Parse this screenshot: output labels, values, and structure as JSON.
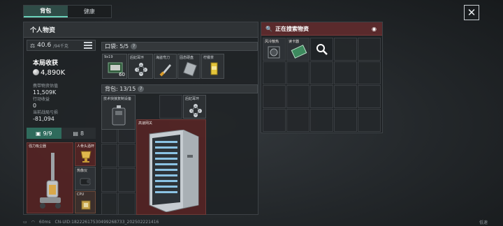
{
  "tabs": [
    {
      "label": "背包",
      "active": true
    },
    {
      "label": "健康",
      "active": false
    }
  ],
  "personal": {
    "title": "个人物资",
    "weight": {
      "value": "40.6",
      "max": "/94千克"
    },
    "round_income_title": "本局收获",
    "round_income_value": "4,890K",
    "carry_label": "携带物资估值",
    "carry_value": "11,509K",
    "action_label": "行动收益",
    "action_value": "0",
    "current_label": "当前战局亏损",
    "current_value": "-81,094",
    "seg_equip": "9/9",
    "seg_other": "8"
  },
  "equipment": {
    "slot1": "强力吸尘器",
    "slot2": "人骨头酒杯",
    "slot3": "热像仪",
    "slot4": "CPU"
  },
  "pocket": {
    "label": "口袋: 5/5",
    "items": [
      {
        "name": "9x19",
        "count": "60"
      },
      {
        "name": "后妃耳环"
      },
      {
        "name": "海盗弯刀"
      },
      {
        "name": "固态硬盘"
      },
      {
        "name": "柠檬茶"
      }
    ]
  },
  "backpack": {
    "label": "背包: 13/15",
    "items": [
      {
        "name": "技术快接复制设备"
      },
      {
        "name": "后妃耳环"
      },
      {
        "name": "高速网关"
      }
    ]
  },
  "search": {
    "title": "正在搜索物资",
    "items": [
      {
        "name": "风冷散热"
      },
      {
        "name": "读卡器"
      },
      {
        "name": "searching"
      }
    ]
  },
  "status": {
    "ping": "60ms",
    "uid": "CN-UID:18222617530499268733_202502221416",
    "right": "低速"
  },
  "colors": {
    "accent": "#6bd3bb",
    "danger": "#7b3a3a"
  }
}
